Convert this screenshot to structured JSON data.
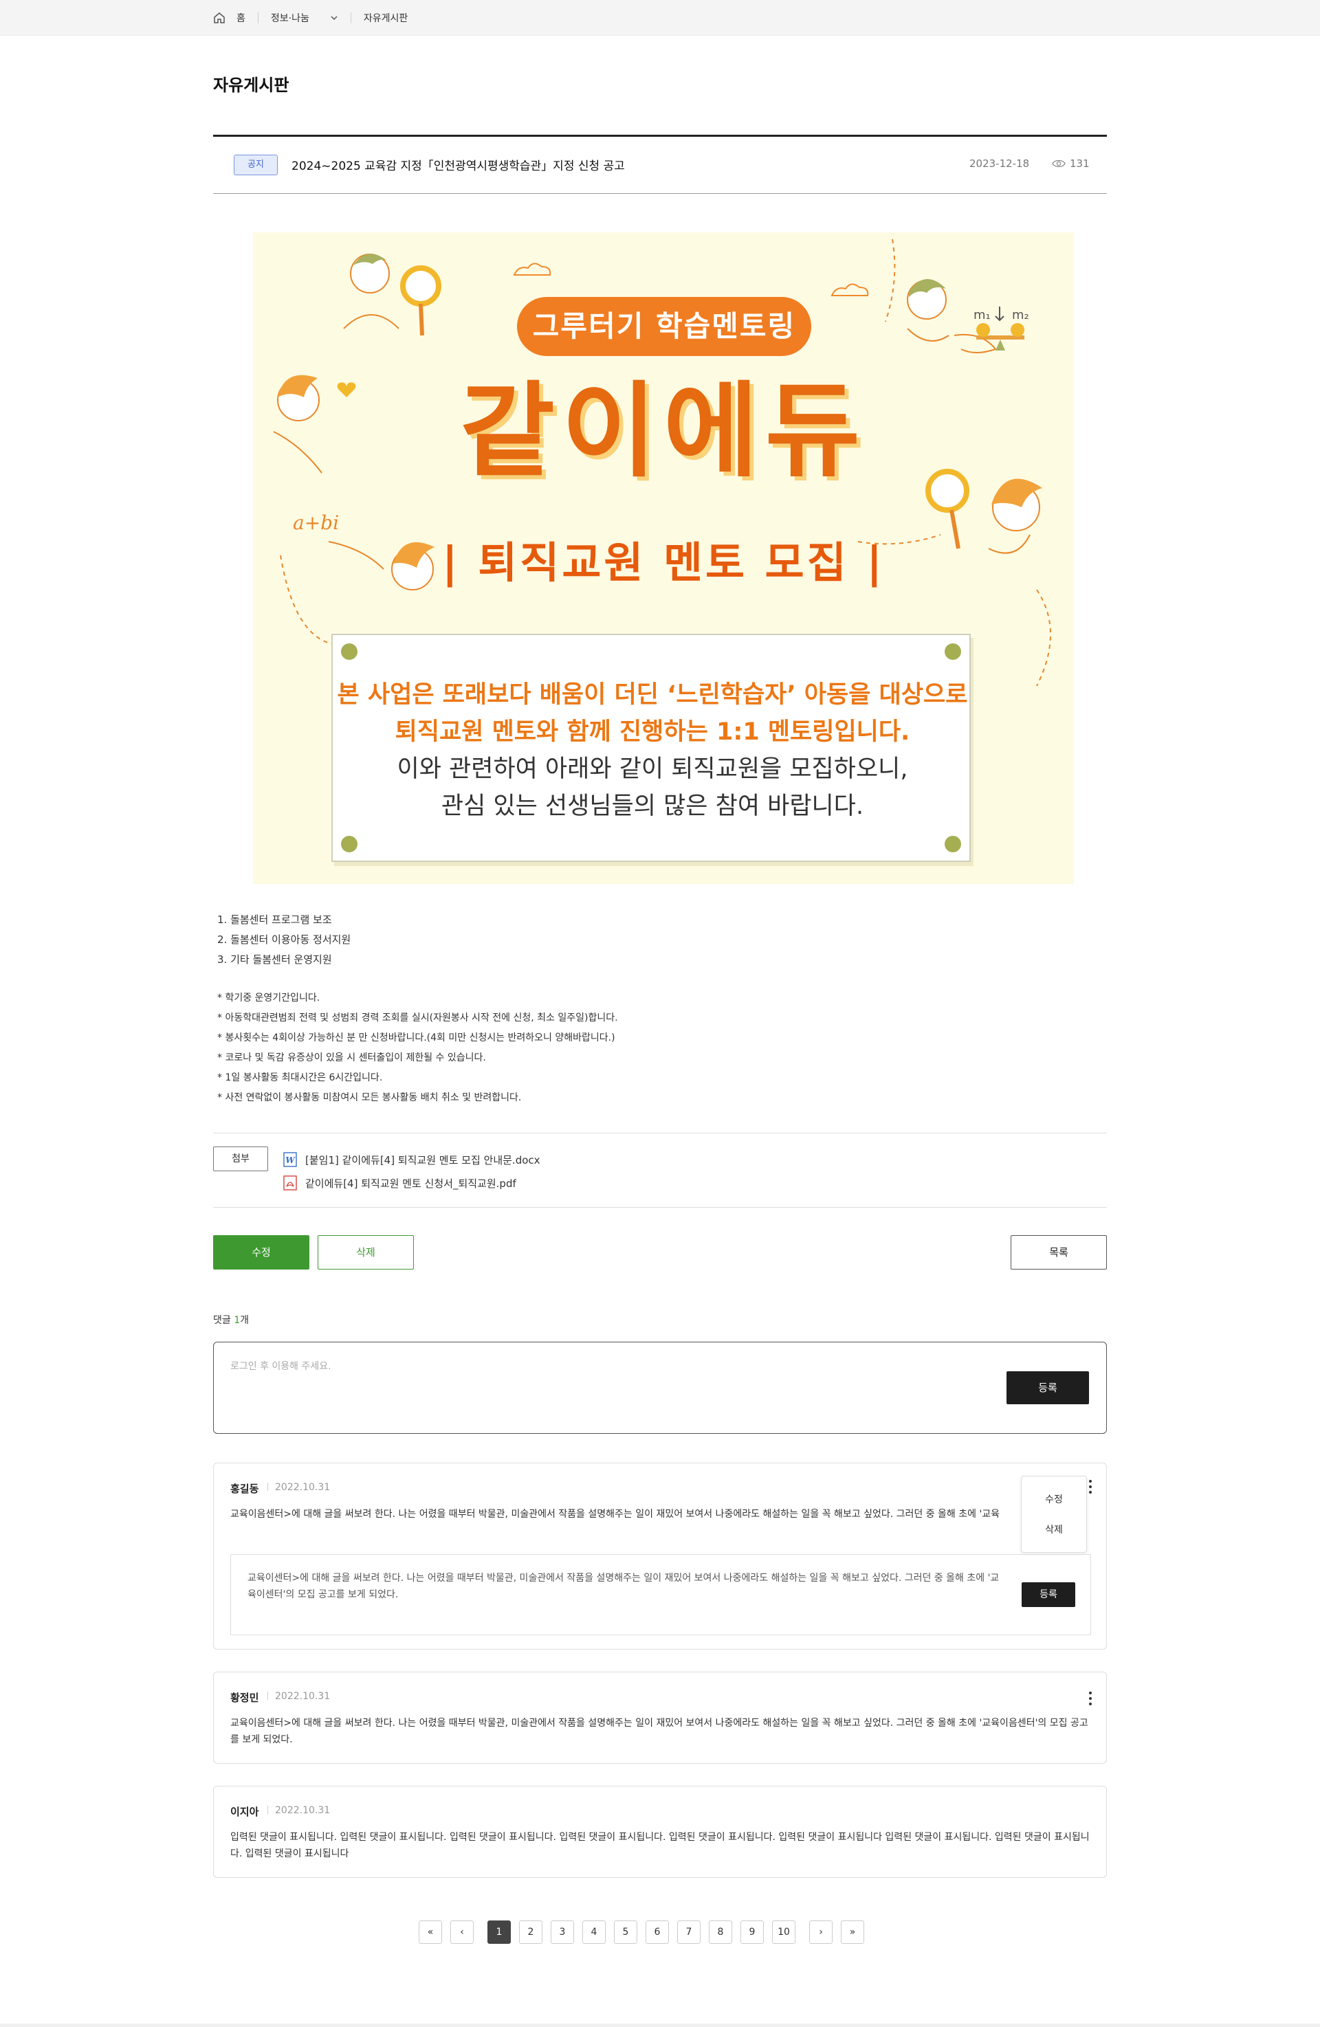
{
  "breadcrumb": {
    "home": "홈",
    "category": "정보·나눔",
    "current": "자유게시판"
  },
  "page_title": "자유게시판",
  "notice": {
    "badge": "공지",
    "title": "2024~2025 교육감 지정「인천광역시평생학습관」지정 신청 공고",
    "date": "2023-12-18",
    "views": "131"
  },
  "poster": {
    "pill": "그루터기 학습멘토링",
    "big_title": "같이에듀",
    "recruit": "| 퇴직교원 멘토 모집 |",
    "line1": "본 사업은 또래보다 배움이 더딘 ‘느린학습자’ 아동을 대상으로",
    "line2": "퇴직교원 멘토와 함께 진행하는 1:1 멘토링입니다.",
    "line3": "이와 관련하여 아래와 같이 퇴직교원을 모집하오니,",
    "line4": "관심 있는 선생님들의 많은 참여 바랍니다.",
    "formula": "a+bi",
    "m1": "m₁",
    "m2": "m₂",
    "colors": {
      "orange": "#e56a10",
      "pill": "#f07d22",
      "background": "#fefbe3",
      "pin": "#a6ae52"
    }
  },
  "duties": [
    "1. 돌봄센터 프로그램 보조",
    "2. 돌봄센터 이용아동 정서지원",
    "3. 기타 돌봄센터 운영지원"
  ],
  "notes": [
    "* 학기중 운영기간입니다.",
    "* 아동학대관련범죄 전력 및 성범죄 경력 조회를 실시(자원봉사 시작 전에 신청, 최소 일주일)합니다.",
    "* 봉사횟수는 4회이상 가능하신 분 만 신청바랍니다.(4회 미만 신청시는 반려하오니 양해바랍니다.)",
    "* 코로나 및 독감 유증상이 있을 시 센터출입이 제한될 수 있습니다.",
    "* 1일 봉사활동 최대시간은 6시간입니다.",
    "* 사전 연락없이 봉사활동 미참여시 모든 봉사활동 배치 취소 및 반려합니다."
  ],
  "attachments": {
    "label": "첨부",
    "files": [
      {
        "name": "[붙임1] 같이에듀[4] 퇴직교원 멘토 모집 안내문.docx",
        "icon": "word-file-icon"
      },
      {
        "name": "같이에듀[4] 퇴직교원 멘토 신청서_퇴직교원.pdf",
        "icon": "pdf-file-icon"
      }
    ]
  },
  "actions": {
    "edit": "수정",
    "delete": "삭제",
    "list": "목록"
  },
  "comments_header": {
    "label": "댓글 ",
    "count": "1",
    "suffix": "개"
  },
  "comment_input": {
    "placeholder": "로그인 후 이용해 주세요.",
    "submit": "등록"
  },
  "comments": [
    {
      "author": "홍길동",
      "date": "2022.10.31",
      "text": "교육이음센터>에 대해 글을 써보려 한다. 나는 어렸을 때부터 박물관, 미술관에서 작품을 설명해주는 일이 재밌어 보여서 나중에라도 해설하는 일을 꼭 해보고 싶었다. 그러던 중 올해 초에 '교육",
      "menu": {
        "edit": "수정",
        "delete": "삭제"
      },
      "reply": {
        "text": "교육이센터>에 대해 글을 써보려 한다. 나는 어렸을 때부터 박물관, 미술관에서 작품을 설명해주는 일이 재밌어 보여서 나중에라도 해설하는 일을 꼭 해보고 싶었다. 그러던 중 올해 초에 '교육이센터'의 모집 공고를 보게 되었다.",
        "submit": "등록"
      }
    },
    {
      "author": "황정민",
      "date": "2022.10.31",
      "text": "교육이음센터>에 대해 글을 써보려 한다. 나는 어렸을 때부터 박물관, 미술관에서 작품을 설명해주는 일이 재밌어 보여서 나중에라도 해설하는 일을 꼭 해보고 싶었다. 그러던 중 올해 초에 '교육이음센터'의 모집 공고를 보게 되었다."
    },
    {
      "author": "이지아",
      "date": "2022.10.31",
      "text": "입력된 댓글이 표시됩니다. 입력된 댓글이 표시됩니다. 입력된 댓글이 표시됩니다. 입력된 댓글이 표시됩니다. 입력된 댓글이 표시됩니다. 입력된 댓글이 표시됩니다 입력된 댓글이 표시됩니다. 입력된 댓글이 표시됩니다. 입력된 댓글이 표시됩니다"
    }
  ],
  "pagination": {
    "first": "«",
    "prev": "‹",
    "next": "›",
    "last": "»",
    "pages": [
      "1",
      "2",
      "3",
      "4",
      "5",
      "6",
      "7",
      "8",
      "9",
      "10"
    ],
    "current": "1"
  }
}
